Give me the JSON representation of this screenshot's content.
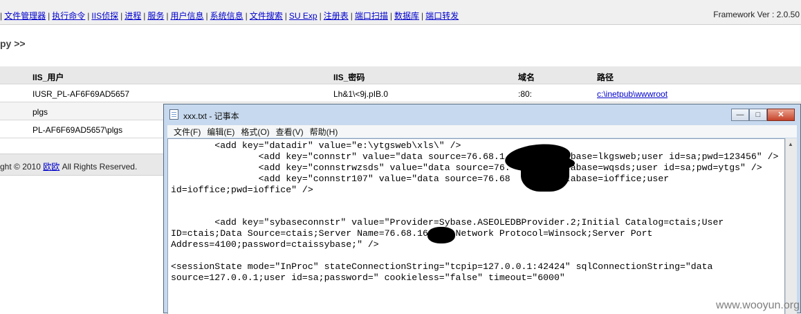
{
  "nav": {
    "links": [
      "文件管理器",
      "执行命令",
      "IIS侦探",
      "进程",
      "服务",
      "用户信息",
      "系统信息",
      "文件搜索",
      "SU Exp",
      "注册表",
      "端口扫描",
      "数据库",
      "端口转发"
    ],
    "separator": "|",
    "framework_version": "Framework Ver : 2.0.50"
  },
  "page": {
    "section_title": "py >>"
  },
  "table": {
    "headers": [
      "IIS_用户",
      "IIS_密码",
      "域名",
      "路径"
    ],
    "rows": [
      {
        "user": "IUSR_PL-AF6F69AD5657",
        "password": "Lh&1\\<9j.pIB.0",
        "domain": ":80:",
        "path": "c:\\inetpub\\wwwroot"
      },
      {
        "user": "plgs"
      },
      {
        "user": "PL-AF6F69AD5657\\plgs"
      }
    ]
  },
  "footer": {
    "prefix": "ght © 2010 ",
    "link": "欧欧",
    "suffix": " All Rights Reserved."
  },
  "notepad": {
    "title": "xxx.txt - 记事本",
    "menu": [
      "文件(F)",
      "编辑(E)",
      "格式(O)",
      "查看(V)",
      "帮助(H)"
    ],
    "buttons": {
      "minimize": "—",
      "maximize": "□",
      "close": "✕"
    },
    "lines": [
      "        <add key=\"datadir\" value=\"e:\\ytgsweb\\xls\\\" />",
      "                <add key=\"connstr\" value=\"data source=76.68.1        database=lkgsweb;user id=sa;pwd=123456\" />",
      "                <add key=\"connstrwzsds\" value=\"data source=76.        database=wqsds;user id=sa;pwd=ytgs\" />",
      "                <add key=\"connstr107\" value=\"data source=76.68        database=ioffice;user",
      "id=ioffice;pwd=ioffice\" />",
      "",
      "",
      "        <add key=\"sybaseconnstr\" value=\"Provider=Sybase.ASEOLEDBProvider.2;Initial Catalog=ctais;User",
      "ID=ctais;Data Source=ctais;Server Name=76.68.16    ;Network Protocol=Winsock;Server Port",
      "Address=4100;password=ctaissybase;\" />",
      "",
      "<sessionState mode=\"InProc\" stateConnectionString=\"tcpip=127.0.0.1:42424\" sqlConnectionString=\"data",
      "source=127.0.0.1;user id=sa;password=\" cookieless=\"false\" timeout=\"6000\""
    ]
  },
  "watermark": "www.wooyun.org"
}
